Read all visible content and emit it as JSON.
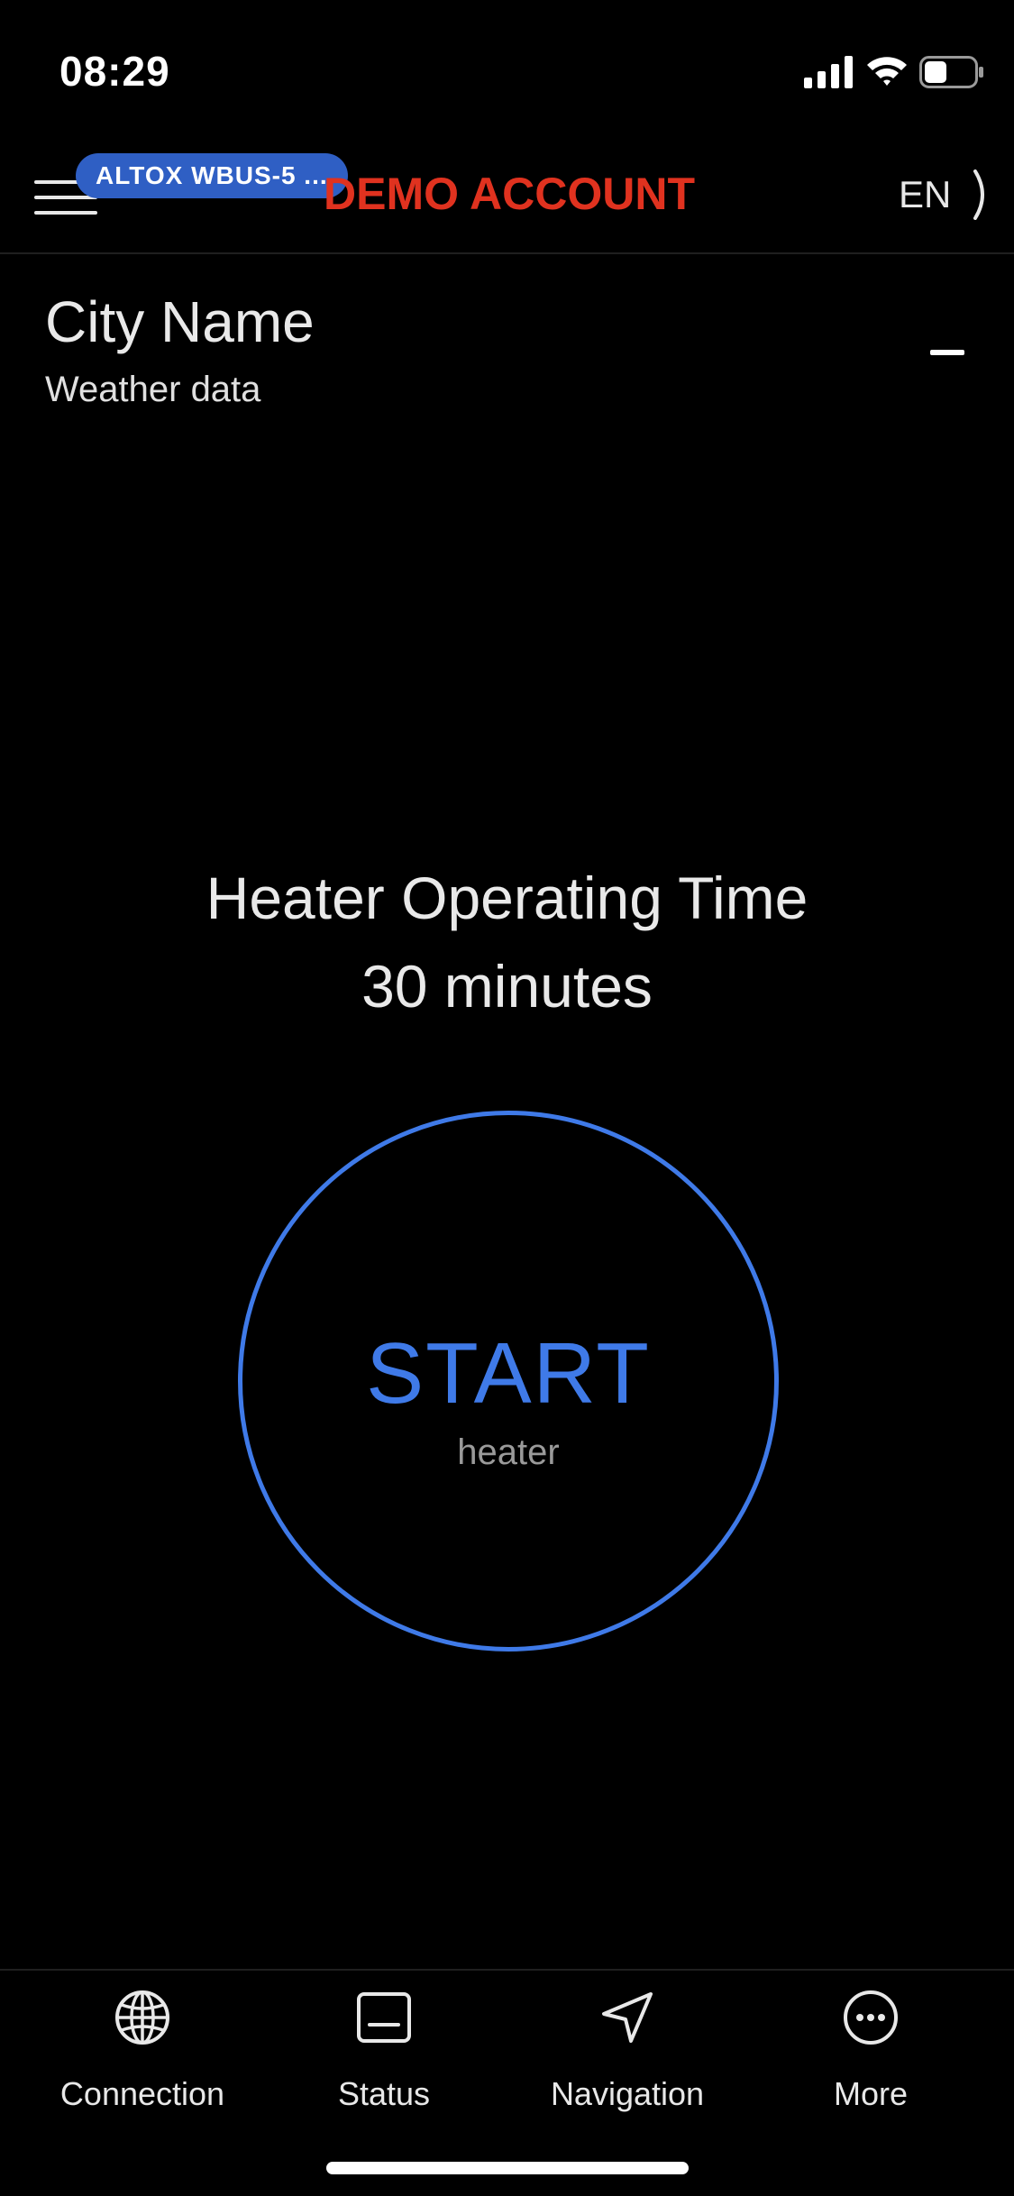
{
  "status_bar": {
    "time": "08:29",
    "icons": [
      "signal-icon",
      "wifi-icon",
      "battery-icon"
    ],
    "battery_level": 0.45
  },
  "header": {
    "device_badge": "ALTOX WBUS-5 ...",
    "title": "DEMO ACCOUNT",
    "language": "EN",
    "colors": {
      "title": "#e0321f",
      "badge": "#2f5fc4"
    }
  },
  "weather": {
    "city": "City Name",
    "subtitle": "Weather data"
  },
  "heater": {
    "title": "Heater Operating Time",
    "duration": "30 minutes",
    "button_label": "START",
    "button_sublabel": "heater",
    "accent": "#3f7ae8"
  },
  "tabs": [
    {
      "label": "Connection",
      "icon": "globe-icon"
    },
    {
      "label": "Status",
      "icon": "status-display-icon"
    },
    {
      "label": "Navigation",
      "icon": "navigation-arrow-icon"
    },
    {
      "label": "More",
      "icon": "more-dots-icon"
    }
  ]
}
